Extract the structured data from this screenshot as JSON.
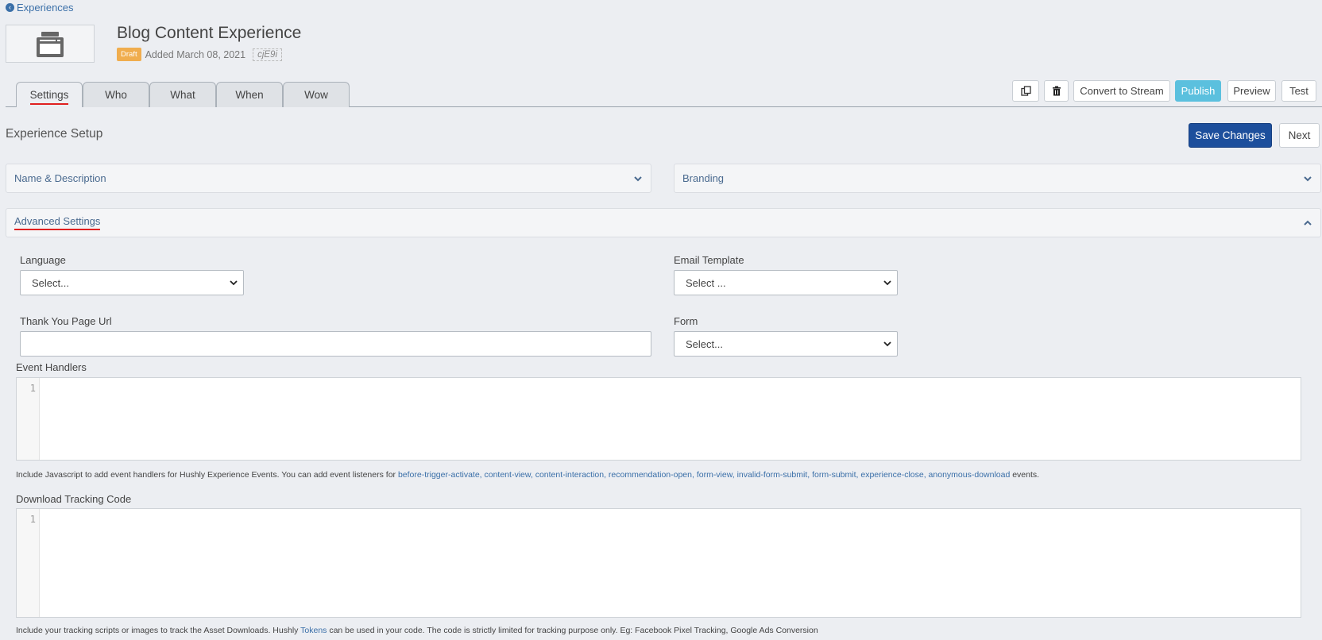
{
  "breadcrumb": {
    "back_label": "Experiences"
  },
  "header": {
    "title": "Blog Content Experience",
    "status_badge": "Draft",
    "added_text": "Added March 08, 2021",
    "code": "cjE9i"
  },
  "tabs": [
    {
      "label": "Settings",
      "active": true
    },
    {
      "label": "Who"
    },
    {
      "label": "What"
    },
    {
      "label": "When"
    },
    {
      "label": "Wow"
    }
  ],
  "toolbar": {
    "copy_icon": "copy-icon",
    "delete_icon": "trash-icon",
    "convert_label": "Convert to Stream",
    "publish_label": "Publish",
    "preview_label": "Preview",
    "test_label": "Test"
  },
  "section": {
    "title": "Experience Setup",
    "save_label": "Save Changes",
    "next_label": "Next"
  },
  "panels": {
    "name_description": "Name & Description",
    "branding": "Branding",
    "advanced": "Advanced Settings"
  },
  "fields": {
    "language": {
      "label": "Language",
      "value": "Select..."
    },
    "email_template": {
      "label": "Email Template",
      "value": "Select ..."
    },
    "thank_you_url": {
      "label": "Thank You Page Url",
      "value": ""
    },
    "form": {
      "label": "Form",
      "value": "Select..."
    }
  },
  "event_handlers": {
    "label": "Event Handlers",
    "line_number": "1",
    "help_prefix": "Include Javascript to add event handlers for Hushly Experience Events. You can add event listeners for ",
    "events": "before-trigger-activate, content-view, content-interaction, recommendation-open, form-view, invalid-form-submit, form-submit, experience-close, anonymous-download",
    "help_suffix": " events."
  },
  "download_tracking": {
    "label": "Download Tracking Code",
    "line_number": "1",
    "help_prefix": "Include your tracking scripts or images to track the Asset Downloads. Hushly ",
    "tokens_link": "Tokens",
    "help_suffix": " can be used in your code. The code is strictly limited for tracking purpose only. Eg: Facebook Pixel Tracking, Google Ads Conversion"
  },
  "colors": {
    "accent": "#1d4f9c",
    "publish": "#5bc0de",
    "draft": "#f0ad4e",
    "link": "#3a6fa8",
    "underline": "#e02020"
  }
}
